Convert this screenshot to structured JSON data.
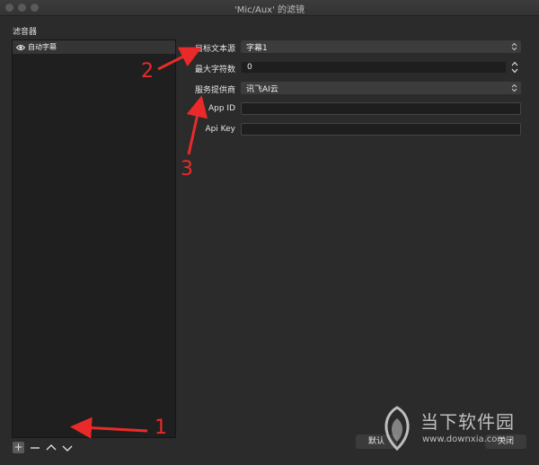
{
  "window": {
    "title": "'Mic/Aux' 的滤镜"
  },
  "filters_panel": {
    "label": "滤音器",
    "items": [
      {
        "label": "自动字幕",
        "icon": "eye-icon"
      }
    ],
    "buttons": {
      "add": "+",
      "remove_icon": "minus-icon",
      "up_icon": "chevron-up-icon",
      "down_icon": "chevron-down-icon"
    }
  },
  "properties": {
    "target_text_source": {
      "label": "目标文本源",
      "value": "字幕1"
    },
    "max_chars": {
      "label": "最大字符数",
      "value": "0"
    },
    "service_provider": {
      "label": "服务提供商",
      "value": "讯飞AI云"
    },
    "app_id": {
      "label": "App ID",
      "value": ""
    },
    "api_key": {
      "label": "Api Key",
      "value": ""
    }
  },
  "dialog_buttons": {
    "defaults": "默认",
    "close": "关闭"
  },
  "annotations": {
    "one": "1",
    "two": "2",
    "three": "3",
    "color": "#ea2a2a"
  },
  "watermark": {
    "name": "当下软件园",
    "url": "www.downxia.com"
  }
}
